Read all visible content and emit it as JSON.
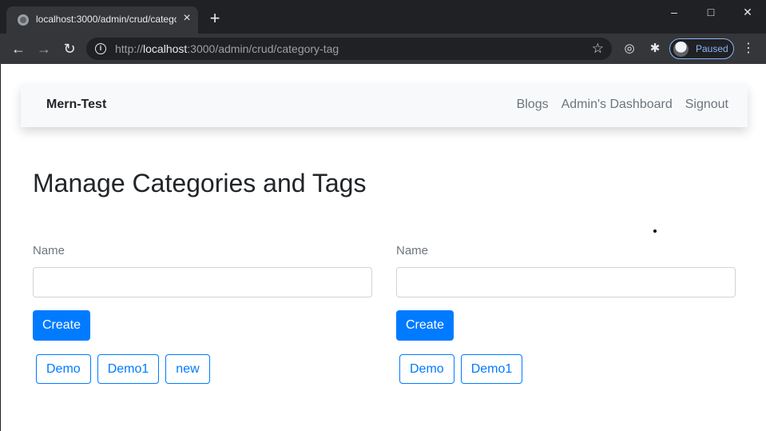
{
  "browser": {
    "tab_title": "localhost:3000/admin/crud/category-tag",
    "url_scheme": "http://",
    "url_host": "localhost",
    "url_rest": ":3000/admin/crud/category-tag",
    "profile_label": "Paused",
    "icons": {
      "close": "close-icon",
      "new_tab": "plus-icon",
      "back": "arrow-left-icon",
      "forward": "arrow-right-icon",
      "reload": "reload-icon",
      "info": "info-icon",
      "star": "star-icon",
      "extension": "puzzle-icon",
      "menu": "kebab-menu-icon"
    },
    "colors": {
      "frame": "#202124",
      "toolbar": "#35363a",
      "accent": "#8ab4f8"
    }
  },
  "navbar": {
    "brand": "Mern-Test",
    "links": [
      "Blogs",
      "Admin's Dashboard",
      "Signout"
    ]
  },
  "main": {
    "title": "Manage Categories and Tags",
    "category_form": {
      "label": "Name",
      "value": "",
      "button": "Create",
      "items": [
        "Demo",
        "Demo1",
        "new"
      ]
    },
    "tag_form": {
      "label": "Name",
      "value": "",
      "button": "Create",
      "items": [
        "Demo",
        "Demo1"
      ]
    }
  },
  "colors": {
    "primary": "#007bff",
    "navbar_bg": "#f8f9fa",
    "text": "#212529",
    "muted": "#6c757d"
  }
}
